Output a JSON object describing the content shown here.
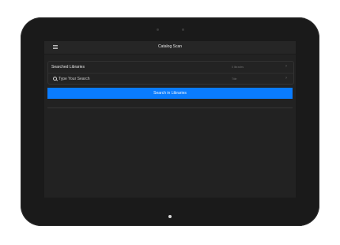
{
  "app": {
    "title": "Catalog Scan"
  },
  "header": {
    "menu_icon": "hamburger-menu-icon"
  },
  "filters": {
    "libraries": {
      "label": "Searched Libraries",
      "value": "0 libraries"
    },
    "search": {
      "placeholder": "Type Your Search",
      "value": "",
      "field": "Title"
    }
  },
  "actions": {
    "search_button": "Search in Libraries"
  },
  "colors": {
    "accent": "#0a7cff",
    "screen_bg": "#222222",
    "bezel": "#1a1a1a"
  }
}
